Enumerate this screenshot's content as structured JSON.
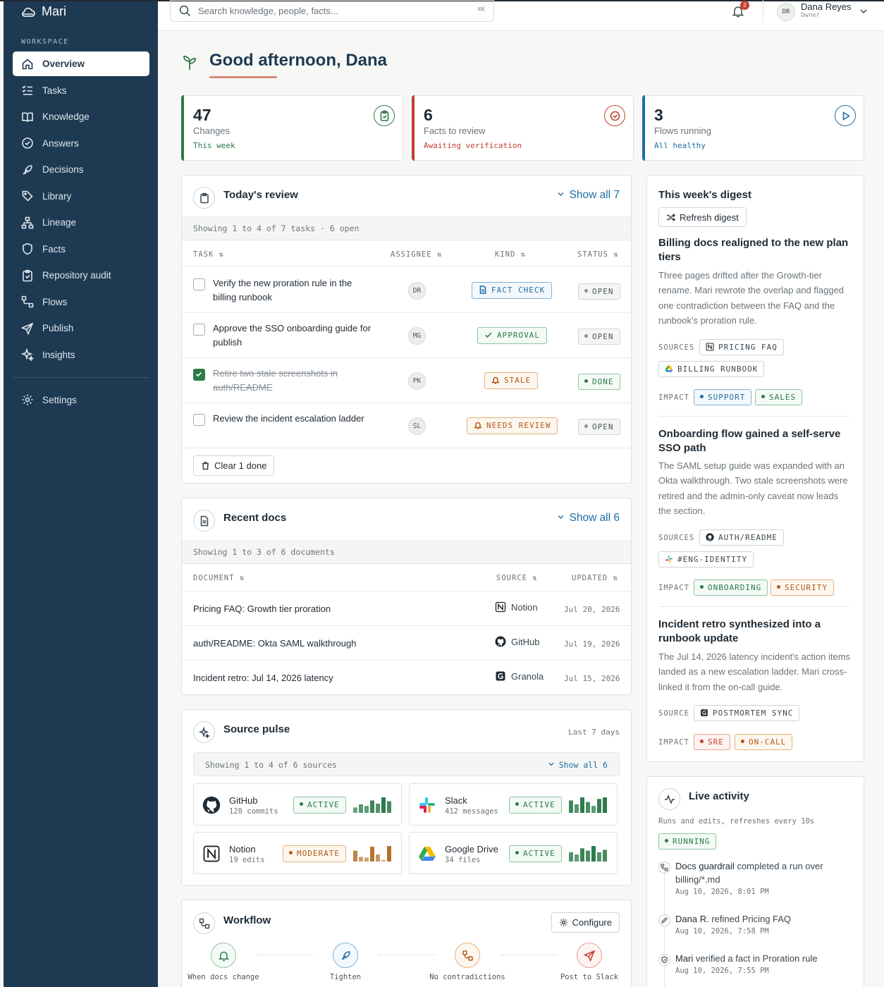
{
  "app": {
    "name": "Mari"
  },
  "sidebar": {
    "section_label": "WORKSPACE",
    "items": [
      {
        "label": "Overview",
        "icon": "home-icon"
      },
      {
        "label": "Tasks",
        "icon": "checklist-icon"
      },
      {
        "label": "Knowledge",
        "icon": "book-icon"
      },
      {
        "label": "Answers",
        "icon": "check-circle-icon"
      },
      {
        "label": "Decisions",
        "icon": "feather-icon"
      },
      {
        "label": "Library",
        "icon": "tag-icon"
      },
      {
        "label": "Lineage",
        "icon": "hierarchy-icon"
      },
      {
        "label": "Facts",
        "icon": "shield-icon"
      },
      {
        "label": "Repository audit",
        "icon": "clipboard-check-icon"
      },
      {
        "label": "Flows",
        "icon": "flow-icon"
      },
      {
        "label": "Publish",
        "icon": "send-icon"
      },
      {
        "label": "Insights",
        "icon": "sparkle-icon"
      }
    ],
    "settings_label": "Settings"
  },
  "topbar": {
    "search_placeholder": "Search knowledge, people, facts...",
    "search_shortcut": "⌘K",
    "notification_count": "2",
    "user": {
      "initials": "DR",
      "name": "Dana Reyes",
      "role": "Owner"
    }
  },
  "greeting": "Good afternoon, Dana",
  "stats": [
    {
      "value": "47",
      "label": "Changes",
      "sub": "This week",
      "color": "#2d7a4a"
    },
    {
      "value": "6",
      "label": "Facts to review",
      "sub": "Awaiting verification",
      "color": "#c2412d"
    },
    {
      "value": "3",
      "label": "Flows running",
      "sub": "All healthy",
      "color": "#1f6ea5"
    }
  ],
  "review": {
    "title": "Today's review",
    "show_all": "Show all 7",
    "summary": "Showing 1 to 4 of 7 tasks · 6 open",
    "columns": [
      "TASK ⇅",
      "ASSIGNEE ⇅",
      "KIND ⇅",
      "STATUS ⇅"
    ],
    "rows": [
      {
        "task": "Verify the new proration rule in the billing runbook",
        "assignee": "DR",
        "kind": "FACT CHECK",
        "status": "OPEN",
        "done": false
      },
      {
        "task": "Approve the SSO onboarding guide for publish",
        "assignee": "MG",
        "kind": "APPROVAL",
        "status": "OPEN",
        "done": false
      },
      {
        "task": "Retire two stale screenshots in auth/README",
        "assignee": "PK",
        "kind": "STALE",
        "status": "DONE",
        "done": true
      },
      {
        "task": "Review the incident escalation ladder",
        "assignee": "SL",
        "kind": "NEEDS REVIEW",
        "status": "OPEN",
        "done": false
      }
    ],
    "clear_label": "Clear 1 done"
  },
  "docs": {
    "title": "Recent docs",
    "show_all": "Show all 6",
    "summary": "Showing 1 to 3 of 6 documents",
    "columns": [
      "DOCUMENT ⇅",
      "SOURCE ⇅",
      "UPDATED ⇅"
    ],
    "rows": [
      {
        "name": "Pricing FAQ: Growth tier proration",
        "source": "Notion",
        "updated": "Jul 20, 2026"
      },
      {
        "name": "auth/README: Okta SAML walkthrough",
        "source": "GitHub",
        "updated": "Jul 19, 2026"
      },
      {
        "name": "Incident retro: Jul 14, 2026 latency",
        "source": "Granola",
        "updated": "Jul 15, 2026"
      }
    ]
  },
  "pulse": {
    "title": "Source pulse",
    "range": "Last 7 days",
    "summary": "Showing 1 to 4 of 6 sources",
    "show_all": "Show all 6",
    "sources": [
      {
        "name": "GitHub",
        "meta": "128 commits",
        "status": "ACTIVE",
        "bars": [
          0.35,
          0.55,
          0.45,
          0.8,
          0.6,
          1.0,
          0.75
        ]
      },
      {
        "name": "Slack",
        "meta": "412 messages",
        "status": "ACTIVE",
        "bars": [
          0.8,
          0.55,
          1.0,
          0.7,
          0.45,
          0.9,
          1.0
        ]
      },
      {
        "name": "Notion",
        "meta": "19 edits",
        "status": "MODERATE",
        "bars": [
          0.7,
          0.3,
          0.25,
          0.95,
          0.45,
          0.1,
          1.0
        ]
      },
      {
        "name": "Google Drive",
        "meta": "34 files",
        "status": "ACTIVE",
        "bars": [
          0.6,
          0.45,
          0.85,
          0.7,
          1.0,
          0.6,
          0.75
        ]
      }
    ]
  },
  "workflow": {
    "title": "Workflow",
    "configure": "Configure",
    "steps": [
      "When docs change",
      "Tighten",
      "No contradictions",
      "Post to Slack"
    ]
  },
  "digest": {
    "title": "This week's digest",
    "refresh": "Refresh digest",
    "items": [
      {
        "title": "Billing docs realigned to the new plan tiers",
        "body": "Three pages drifted after the Growth-tier rename. Mari rewrote the overlap and flagged one contradiction between the FAQ and the runbook's proration rule.",
        "sources_label": "SOURCES",
        "sources": [
          "PRICING FAQ",
          "BILLING RUNBOOK"
        ],
        "impact_label": "IMPACT",
        "impact": [
          "SUPPORT",
          "SALES"
        ]
      },
      {
        "title": "Onboarding flow gained a self-serve SSO path",
        "body": "The SAML setup guide was expanded with an Okta walkthrough. Two stale screenshots were retired and the admin-only caveat now leads the section.",
        "sources_label": "SOURCES",
        "sources": [
          "AUTH/README",
          "#ENG-IDENTITY"
        ],
        "impact_label": "IMPACT",
        "impact": [
          "ONBOARDING",
          "SECURITY"
        ]
      },
      {
        "title": "Incident retro synthesized into a runbook update",
        "body": "The Jul 14, 2026 latency incident's action items landed as a new escalation ladder. Mari cross-linked it from the on-call guide.",
        "sources_label": "SOURCE",
        "sources": [
          "POSTMORTEM SYNC"
        ],
        "impact_label": "IMPACT",
        "impact": [
          "SRE",
          "ON-CALL"
        ]
      }
    ]
  },
  "activity": {
    "title": "Live activity",
    "subtitle": "Runs and edits, refreshes every 10s",
    "status": "RUNNING",
    "events": [
      {
        "actor": "Docs guardrail",
        "text": "completed a run over billing/*.md",
        "time": "Aug 10, 2026, 8:01 PM"
      },
      {
        "actor": "Dana R.",
        "text": "refined Pricing FAQ",
        "time": "Aug 10, 2026, 7:58 PM"
      },
      {
        "actor": "Mari",
        "text": "verified a fact in Proration rule",
        "time": "Aug 10, 2026, 7:55 PM"
      }
    ]
  }
}
